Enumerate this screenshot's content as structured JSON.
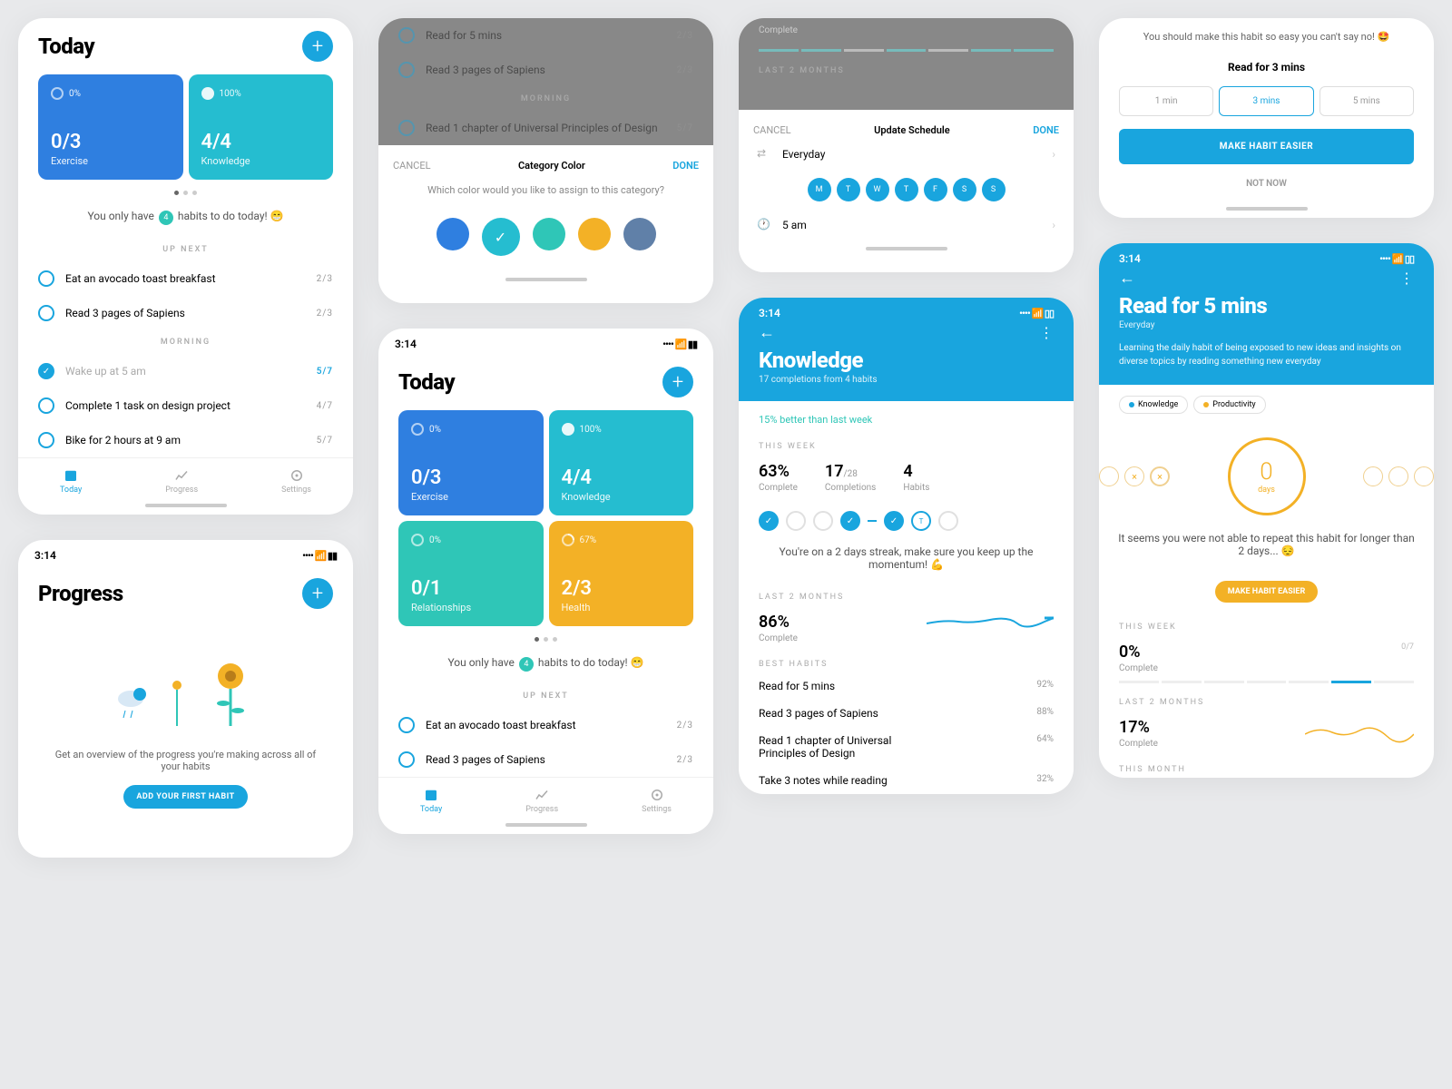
{
  "status_time": "3:14",
  "today": {
    "title": "Today",
    "cards": [
      {
        "pct": "0%",
        "count": "0/3",
        "label": "Exercise",
        "color": "c-blue",
        "check": false
      },
      {
        "pct": "100%",
        "count": "4/4",
        "label": "Knowledge",
        "color": "c-teal",
        "check": true
      },
      {
        "pct": "0%",
        "count": "0/1",
        "label": "Relationships",
        "color": "c-lteal",
        "check": false
      },
      {
        "pct": "67%",
        "count": "2/3",
        "label": "Health",
        "color": "c-amber",
        "check": false
      }
    ],
    "encourage_pre": "You only have ",
    "encourage_num": "4",
    "encourage_post": " habits to do today! 😁",
    "upnext_label": "UP NEXT",
    "morning_label": "MORNING",
    "upnext": [
      {
        "name": "Eat an avocado toast breakfast",
        "p": "2/3"
      },
      {
        "name": "Read 3 pages of Sapiens",
        "p": "2/3"
      }
    ],
    "morning": [
      {
        "name": "Wake up at 5 am",
        "p": "5/7",
        "done": true
      },
      {
        "name": "Complete 1 task on design project",
        "p": "4/7"
      },
      {
        "name": "Bike for 2 hours at 9 am",
        "p": "5/7"
      }
    ]
  },
  "tabs": {
    "today": "Today",
    "progress": "Progress",
    "settings": "Settings"
  },
  "colorModal": {
    "bg_habits": [
      {
        "name": "Read for 5 mins",
        "p": "2/3"
      },
      {
        "name": "Read 3 pages of Sapiens",
        "p": "2/3"
      }
    ],
    "bg_section": "MORNING",
    "bg_habit3": {
      "name": "Read 1 chapter of Universal Principles of Design",
      "p": "5/7"
    },
    "cancel": "CANCEL",
    "title": "Category Color",
    "done": "DONE",
    "sub": "Which color would you like to assign to this category?",
    "colors": [
      "#2f7fe0",
      "#25bdd0",
      "#2fc6b7",
      "#f3b126",
      "#6080a8"
    ]
  },
  "schedule": {
    "bg_label": "Complete",
    "bg_section": "LAST 2 MONTHS",
    "cancel": "CANCEL",
    "title": "Update Schedule",
    "done": "DONE",
    "freq": "Everyday",
    "days": [
      "M",
      "T",
      "W",
      "T",
      "F",
      "S",
      "S"
    ],
    "time": "5 am"
  },
  "knowledge": {
    "title": "Knowledge",
    "sub": "17 completions from 4 habits",
    "improve": "15% better than last week",
    "this_week": "THIS WEEK",
    "stats": [
      {
        "v": "63%",
        "l": "Complete"
      },
      {
        "v": "17",
        "sm": "/28",
        "l": "Completions"
      },
      {
        "v": "4",
        "l": "Habits"
      }
    ],
    "streak_msg": "You're on a 2 days streak, make sure you keep up the momentum! 💪",
    "last2": "LAST 2 MONTHS",
    "last2_v": "86%",
    "last2_l": "Complete",
    "best": "BEST HABITS",
    "best_list": [
      {
        "n": "Read for 5 mins",
        "p": "92%"
      },
      {
        "n": "Read 3 pages of Sapiens",
        "p": "88%"
      },
      {
        "n": "Read 1 chapter of Universal Principles of Design",
        "p": "64%"
      },
      {
        "n": "Take 3 notes while reading",
        "p": "32%"
      }
    ]
  },
  "easier": {
    "sub": "You should make this habit so easy you can't say no! 🤩",
    "title": "Read for 3 mins",
    "opts": [
      "1 min",
      "3 mins",
      "5 mins"
    ],
    "btn": "MAKE HABIT EASIER",
    "skip": "NOT NOW"
  },
  "progress": {
    "title": "Progress",
    "msg": "Get an overview of the progress you're making across all of your habits",
    "btn": "ADD YOUR FIRST HABIT"
  },
  "habitDetail": {
    "title": "Read for 5 mins",
    "sub": "Everyday",
    "desc": "Learning the daily habit of being exposed to new ideas and insights on diverse topics by reading something new everyday",
    "tags": [
      {
        "n": "Knowledge",
        "c": "#19a5de"
      },
      {
        "n": "Productivity",
        "c": "#f3b126"
      }
    ],
    "days_n": "0",
    "days_l": "days",
    "fail_msg": "It seems you were not able to repeat this habit for longer than 2 days... 😔",
    "btn": "MAKE HABIT EASIER",
    "this_week": "THIS WEEK",
    "tw_v": "0%",
    "tw_l": "Complete",
    "tw_p": "0/7",
    "last2": "LAST 2 MONTHS",
    "l2_v": "17%",
    "l2_l": "Complete",
    "this_month": "THIS MONTH"
  }
}
